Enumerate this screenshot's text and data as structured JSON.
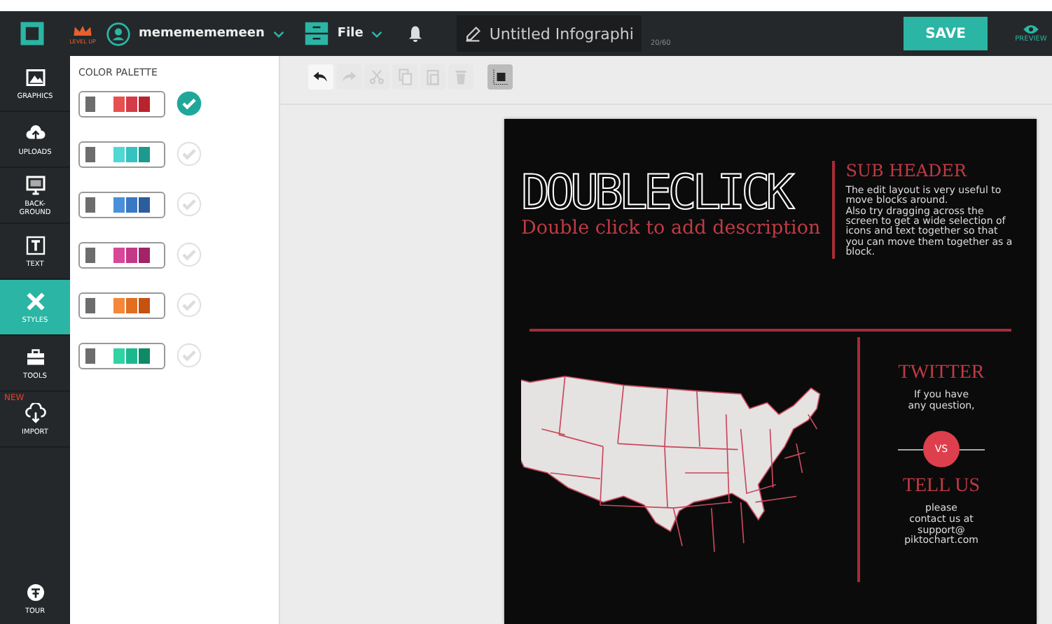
{
  "topbar": {
    "level_up": "LEVEL UP",
    "username": "mememememeen",
    "file_menu": "File",
    "doc_title": "Untitled Infographi",
    "char_count": "20/60",
    "save": "SAVE",
    "preview": "PREVIEW"
  },
  "sidebar": {
    "items": [
      {
        "label": "GRAPHICS",
        "kind": "graphics",
        "selected": false
      },
      {
        "label": "UPLOADS",
        "kind": "uploads",
        "selected": false
      },
      {
        "label": "BACK-GROUND",
        "kind": "background",
        "selected": false
      },
      {
        "label": "TEXT",
        "kind": "text",
        "selected": false
      },
      {
        "label": "STYLES",
        "kind": "styles",
        "selected": true
      },
      {
        "label": "TOOLS",
        "kind": "tools",
        "selected": false
      },
      {
        "label": "IMPORT",
        "kind": "import",
        "selected": false,
        "badge": "NEW"
      }
    ],
    "tour": "TOUR"
  },
  "panel": {
    "title": "COLOR PALETTE",
    "palettes": [
      {
        "swatches": [
          {
            "color": "#6d6d6d"
          },
          {
            "color": "#e8504f"
          },
          {
            "color": "#d33c48"
          },
          {
            "color": "#b8232f"
          }
        ],
        "selected": true
      },
      {
        "swatches": [
          {
            "color": "#6d6d6d"
          },
          {
            "color": "#4fd8d4"
          },
          {
            "color": "#36c2c0"
          },
          {
            "color": "#1b9a8e"
          }
        ],
        "selected": false
      },
      {
        "swatches": [
          {
            "color": "#6d6d6d"
          },
          {
            "color": "#4a90d9"
          },
          {
            "color": "#3b78c4"
          },
          {
            "color": "#2b5e9c"
          }
        ],
        "selected": false
      },
      {
        "swatches": [
          {
            "color": "#6d6d6d"
          },
          {
            "color": "#d8479a"
          },
          {
            "color": "#c33987"
          },
          {
            "color": "#a12468"
          }
        ],
        "selected": false
      },
      {
        "swatches": [
          {
            "color": "#6d6d6d"
          },
          {
            "color": "#f5873a"
          },
          {
            "color": "#e06f22"
          },
          {
            "color": "#c5520f"
          }
        ],
        "selected": false
      },
      {
        "swatches": [
          {
            "color": "#6d6d6d"
          },
          {
            "color": "#2fd3a4"
          },
          {
            "color": "#1bb88e"
          },
          {
            "color": "#0f8a66"
          }
        ],
        "selected": false
      }
    ]
  },
  "toolbar": [
    {
      "kind": "undo",
      "disabled": false
    },
    {
      "kind": "redo",
      "disabled": true
    },
    {
      "kind": "cut",
      "disabled": true
    },
    {
      "kind": "copy",
      "disabled": true
    },
    {
      "kind": "paste",
      "disabled": true
    },
    {
      "kind": "delete",
      "disabled": true
    },
    {
      "kind": "grid",
      "disabled": false
    }
  ],
  "infographic": {
    "title": "DOUBLECLICK",
    "description": "Double click to add description",
    "sub_header": "SUB HEADER",
    "body": "The edit layout is very useful to move blocks around.\nAlso try dragging across the screen to get a wide selection of icons and text together so that you can move them together as a block.",
    "twitter": "TWITTER",
    "twitter_text": "If you have\nany question,",
    "vs": "VS",
    "tell_us": "TELL US",
    "tell_text": "please\ncontact us at\nsupport@\npiktochart.com"
  }
}
